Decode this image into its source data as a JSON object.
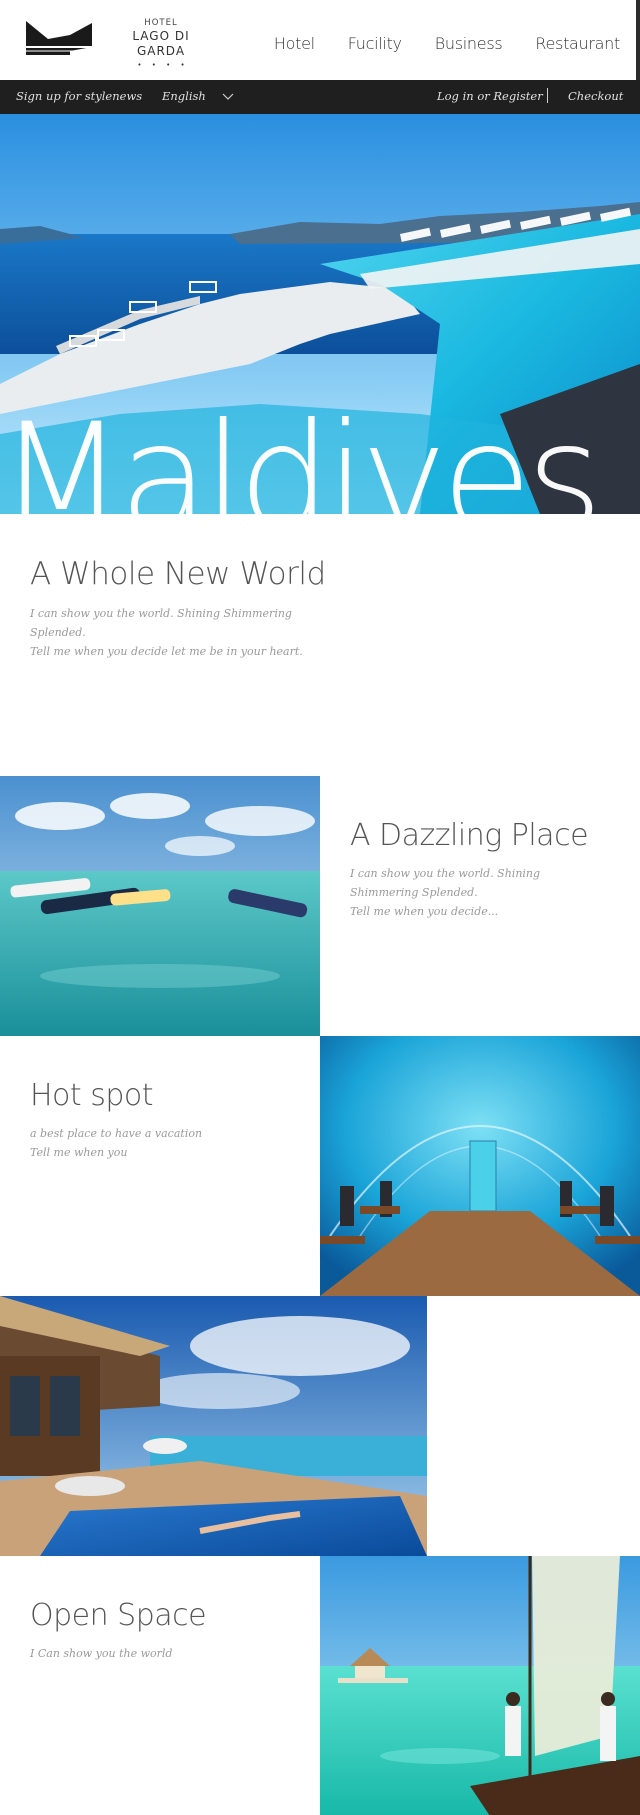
{
  "header": {
    "logo": {
      "top_line": "HOTEL",
      "name": "LAGO DI GARDA",
      "stars": "• • • •"
    },
    "nav": [
      "Hotel",
      "Fucility",
      "Business",
      "Restaurant"
    ]
  },
  "topbar": {
    "signup": "Sign up for stylenews",
    "language": "English",
    "login": "Log in or Register",
    "checkout": "Checkout"
  },
  "hero": {
    "word": "Maldives"
  },
  "intro": {
    "title": "A Whole New World",
    "line1": "I can show you the world. Shining Shimmering Splended.",
    "line2": "Tell me when you decide let me be in your heart."
  },
  "dazzling": {
    "title": "A Dazzling Place",
    "line1": "I can show you the world. Shining Shimmering Splended.",
    "line2": "Tell me when you decide..."
  },
  "hotspot": {
    "title": "Hot spot",
    "line1": "a best place to have a vacation",
    "line2": "Tell me when you"
  },
  "openspace": {
    "title": "Open Space",
    "line1": "I Can show you the world"
  },
  "colors": {
    "topbar": "#1f1f1f",
    "title": "#555555",
    "text": "#9a9a9a"
  },
  "icons": [
    "hotel-logo-mark-icon",
    "chevron-down-icon"
  ]
}
